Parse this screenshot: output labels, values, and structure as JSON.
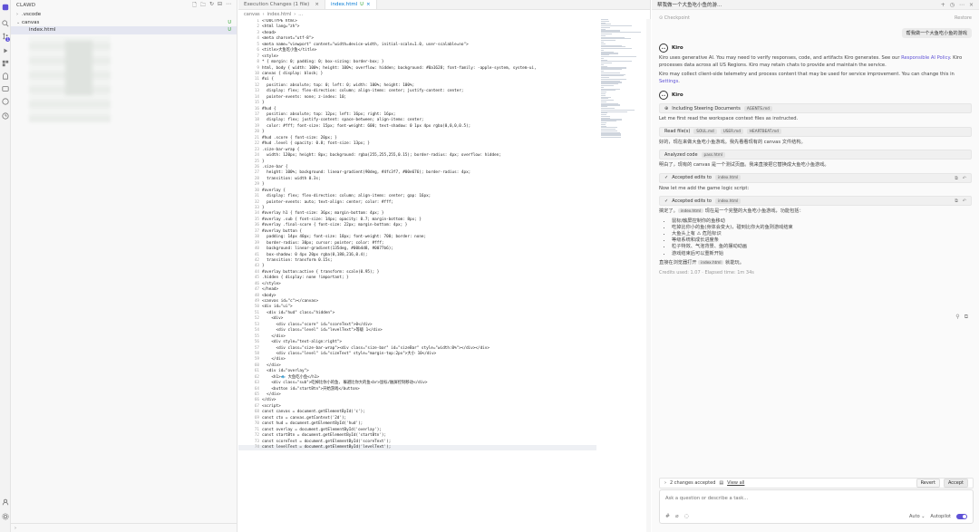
{
  "explorer": {
    "title": "CLAWD",
    "tree": [
      {
        "name": ".vscode",
        "chev": "›",
        "indent": 6,
        "badge": ""
      },
      {
        "name": "canvas",
        "chev": "⌄",
        "indent": 6,
        "badge": "U"
      },
      {
        "name": "index.html",
        "chev": "",
        "indent": 14,
        "badge": "U",
        "selected": true
      }
    ]
  },
  "editor": {
    "tabs": [
      {
        "label": "Execution Changes (1 file)",
        "badge": "",
        "active": false
      },
      {
        "label": "index.html",
        "badge": "U",
        "active": true
      }
    ],
    "breadcrumb": [
      "canvas",
      "›",
      "index.html",
      "›",
      "..."
    ],
    "lines": [
      "<!DOCTYPE html>",
      "<html lang=\"zh\">",
      "<head>",
      "<meta charset=\"utf-8\">",
      "<meta name=\"viewport\" content=\"width=device-width, initial-scale=1.0, user-scalable=no\">",
      "<title>大鱼吃小鱼</title>",
      "<style>",
      "* { margin: 0; padding: 0; box-sizing: border-box; }",
      "html, body { width: 100%; height: 100%; overflow: hidden; background: #0a1628; font-family: -apple-system, system-ui, ",
      "canvas { display: block; }",
      "#ui {",
      "  position: absolute; top: 0; left: 0; width: 100%; height: 100%;",
      "  display: flex; flex-direction: column; align-items: center; justify-content: center;",
      "  pointer-events: none; z-index: 10;",
      "}",
      "#hud {",
      "  position: absolute; top: 12px; left: 16px; right: 16px;",
      "  display: flex; justify-content: space-between; align-items: center;",
      "  color: #fff; font-size: 15px; font-weight: 600; text-shadow: 0 1px 4px rgba(0,0,0,0.5);",
      "}",
      "#hud .score { font-size: 20px; }",
      "#hud .level { opacity: 0.8; font-size: 13px; }",
      ".size-bar-wrap {",
      "  width: 120px; height: 8px; background: rgba(255,255,255,0.15); border-radius: 4px; overflow: hidden;",
      "}",
      ".size-bar {",
      "  height: 100%; background: linear-gradient(90deg, #4fc3f7, #00e676); border-radius: 4px;",
      "  transition: width 0.3s;",
      "}",
      "#overlay {",
      "  display: flex; flex-direction: column; align-items: center; gap: 16px;",
      "  pointer-events: auto; text-align: center; color: #fff;",
      "}",
      "#overlay h1 { font-size: 36px; margin-bottom: 4px; }",
      "#overlay .sub { font-size: 14px; opacity: 0.7; margin-bottom: 8px; }",
      "#overlay .final-score { font-size: 22px; margin-bottom: 4px; }",
      "#overlay button {",
      "  padding: 14px 40px; font-size: 18px; font-weight: 700; border: none;",
      "  border-radius: 30px; cursor: pointer; color: #fff;",
      "  background: linear-gradient(135deg, #00b4d8, #0077b6);",
      "  box-shadow: 0 4px 20px rgba(0,180,216,0.4);",
      "  transition: transform 0.15s;",
      "}",
      "#overlay button:active { transform: scale(0.95); }",
      ".hidden { display: none !important; }",
      "</style>",
      "</head>",
      "<body>",
      "<canvas id=\"c\"></canvas>",
      "<div id=\"ui\">",
      "  <div id=\"hud\" class=\"hidden\">",
      "    <div>",
      "      <div class=\"score\" id=\"scoreText\">0</div>",
      "      <div class=\"level\" id=\"levelText\">等级 1</div>",
      "    </div>",
      "    <div style=\"text-align:right\">",
      "      <div class=\"size-bar-wrap\"><div class=\"size-bar\" id=\"sizeBar\" style=\"width:0%\"></div></div>",
      "      <div class=\"level\" id=\"sizeText\" style=\"margin-top:2px\">大小 10</div>",
      "    </div>",
      "  </div>",
      "  <div id=\"overlay\">",
      "    <h1>🐟 大鱼吃小鱼</h1>",
      "    <div class=\"sub\">吃掉比你小的鱼, 躲避比你大的鱼<br>鼠标/触屏控制移动</div>",
      "    <button id=\"startBtn\">开始游戏</button>",
      "  </div>",
      "</div>",
      "<script>",
      "const canvas = document.getElementById('c');",
      "const ctx = canvas.getContext('2d');",
      "const hud = document.getElementById('hud');",
      "const overlay = document.getElementById('overlay');",
      "const startBtn = document.getElementById('startBtn');",
      "const scoreText = document.getElementById('scoreText');",
      "const levelText = document.getElementById('levelText');"
    ]
  },
  "chat": {
    "title": "帮我做一个大鱼吃小鱼的游...",
    "checkpoint": "Checkpoint",
    "restore": "Restore",
    "user_message": "帮我做一个大鱼吃小鱼的游戏",
    "intro_name": "Kiro",
    "intro_p1": "Kiro uses generative AI. You may need to verify responses, code, and artifacts Kiro generates. See our ",
    "intro_link": "Responsible AI Policy",
    "intro_p1b": ". Kiro processes data across all US Regions. Kiro may retain chats to provide and maintain the service.",
    "intro_p2": "Kiro may collect client-side telemetry and process content that may be used for service improvement. You can change this in ",
    "intro_link2": "Settings",
    "agent_name": "Kiro",
    "steering_label": "Including Steering Documents",
    "steering_chip": "AGENTS.md",
    "read_workspace": "Let me first read the workspace context files as instructed.",
    "readfiles_label": "Read file(s)",
    "readfiles_chips": [
      "SOUL.md",
      "USER.md",
      "HEARTBEAT.md"
    ],
    "zh_1": "好的，现在来做大鱼吃小鱼游戏。我先看看现有的 canvas 文件结构。",
    "analyzed_label": "Analyzed code",
    "analyzed_chip": "pass.html",
    "zh_2": "明白了，现有的 canvas 是一个测试页面。我来直接把它替换成大鱼吃小鱼游戏。",
    "edits1_label": "Accepted edits to",
    "edits1_chip": "index.html",
    "logic_text": "Now let me add the game logic script:",
    "edits2_label": "Accepted edits to",
    "edits2_chip": "index.html",
    "summary_prefix": "搞定了。",
    "summary_chip": "index.html",
    "summary_suffix": " 现在是一个完整的大鱼吃小鱼游戏，功能包括：",
    "features": [
      "鼠标/触屏控制你的鱼移动",
      "吃掉比你小的鱼(身体会变大)，碰到比你大的鱼则游戏结束",
      "大鱼头上有 ⚠ 危险标识",
      "等级系统和成长进度条",
      "粒子特效、气泡背景、鱼的摆动动画",
      "游戏结束后可以重新开始"
    ],
    "open_prefix": "直接在浏览器打开 ",
    "open_chip": "index.html",
    "open_suffix": " 就能玩。",
    "credits": "Credits used: 1.07",
    "elapsed": "Elapsed time: 1m 34s",
    "changes_count": "2 changes accepted",
    "view_all": "View all",
    "revert": "Revert",
    "accept": "Accept",
    "input_placeholder": "Ask a question or describe a task...",
    "mode": "Auto",
    "autopilot": "Autopilot"
  }
}
